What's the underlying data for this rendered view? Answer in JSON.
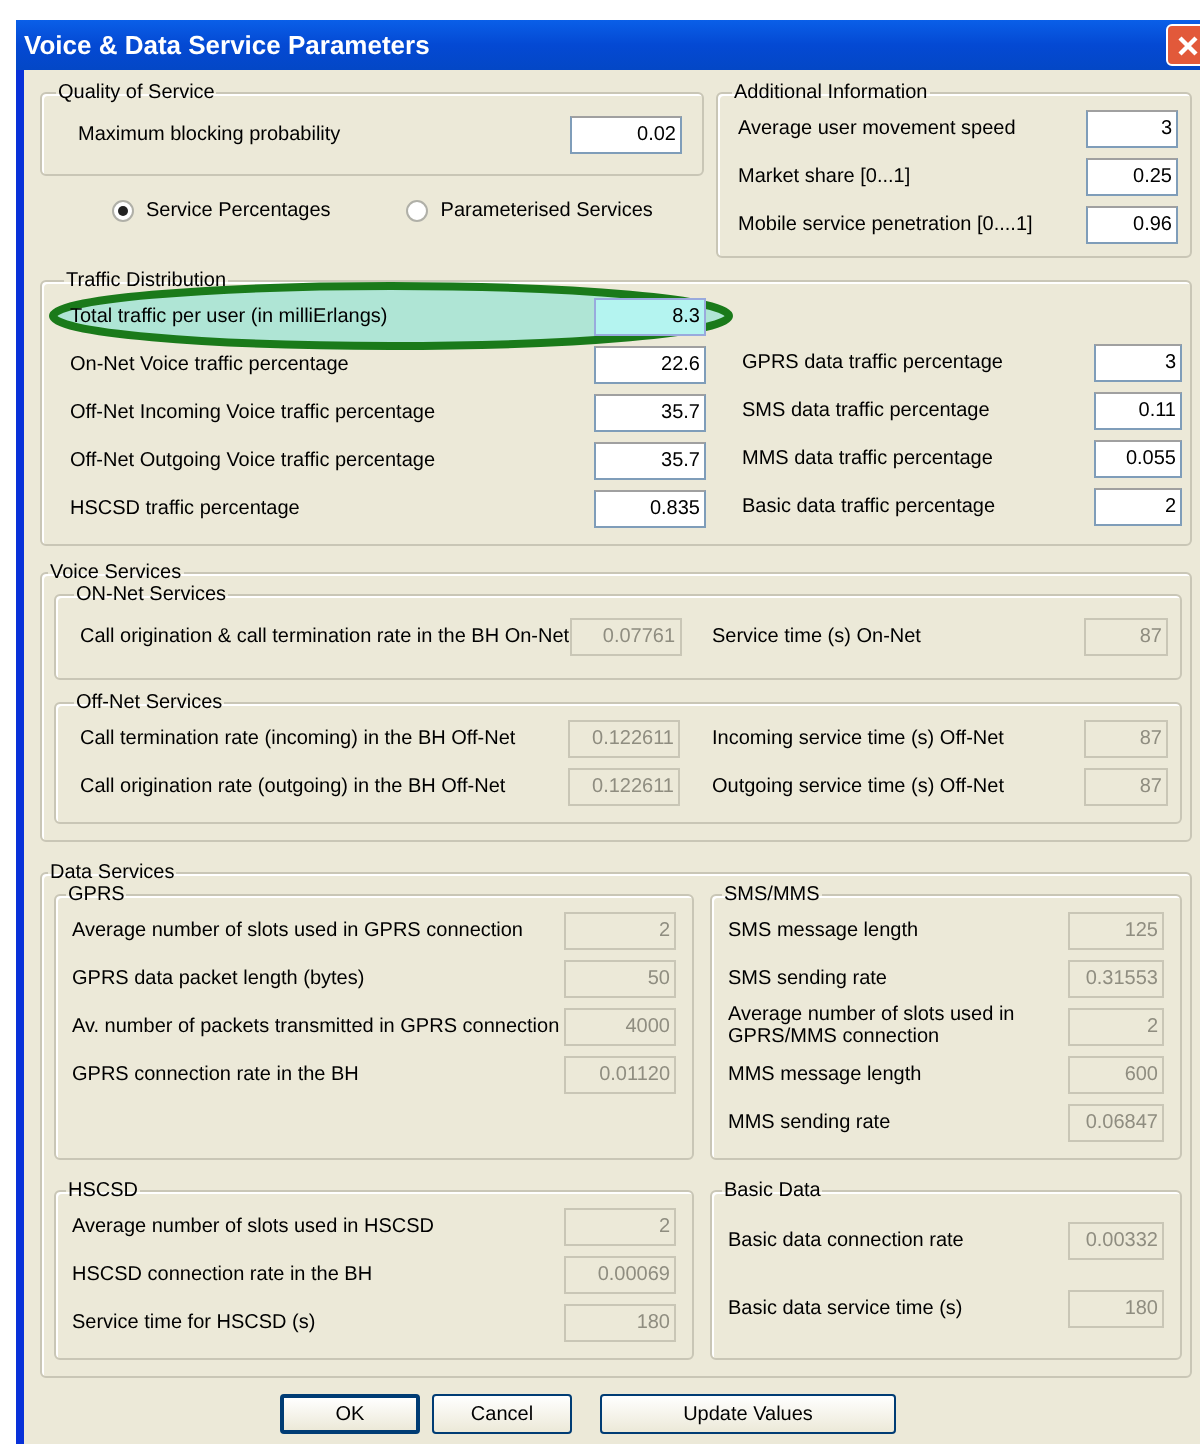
{
  "window": {
    "title": "Voice & Data Service Parameters"
  },
  "quality_of_service": {
    "title": "Quality of Service",
    "fields": [
      {
        "label": "Maximum blocking probability",
        "value": "0.02",
        "disabled": false
      }
    ]
  },
  "service_mode": [
    {
      "label": "Service Percentages",
      "selected": true
    },
    {
      "label": "Parameterised Services",
      "selected": false
    }
  ],
  "additional_information": {
    "title": "Additional Information",
    "fields": [
      {
        "label": "Average user movement speed",
        "value": "3",
        "disabled": false
      },
      {
        "label": "Market share  [0...1]",
        "value": "0.25",
        "disabled": false
      },
      {
        "label": "Mobile service penetration   [0....1]",
        "value": "0.96",
        "disabled": false
      }
    ]
  },
  "traffic_distribution": {
    "title": "Traffic Distribution",
    "left": [
      {
        "label": "Total traffic per user (in milliErlangs)",
        "value": "8.3",
        "disabled": false,
        "highlighted": true
      },
      {
        "label": "On-Net Voice traffic percentage",
        "value": "22.6",
        "disabled": false,
        "highlighted": false
      },
      {
        "label": "Off-Net Incoming Voice traffic percentage",
        "value": "35.7",
        "disabled": false,
        "highlighted": false
      },
      {
        "label": "Off-Net Outgoing Voice traffic percentage",
        "value": "35.7",
        "disabled": false,
        "highlighted": false
      },
      {
        "label": "HSCSD traffic percentage",
        "value": "0.835",
        "disabled": false,
        "highlighted": false
      }
    ],
    "right": [
      {
        "label": "GPRS data traffic percentage",
        "value": "3",
        "disabled": false
      },
      {
        "label": "SMS data traffic percentage",
        "value": "0.11",
        "disabled": false
      },
      {
        "label": "MMS data traffic percentage",
        "value": "0.055",
        "disabled": false
      },
      {
        "label": "Basic data traffic percentage",
        "value": "2",
        "disabled": false
      }
    ]
  },
  "voice_services": {
    "title": "Voice Services",
    "groups": [
      {
        "title": "ON-Net Services",
        "left": [
          {
            "label": "Call origination & call termination rate in the BH On-Net",
            "value": "0.07761",
            "disabled": true
          }
        ],
        "right": [
          {
            "label": "Service time (s) On-Net",
            "value": "87",
            "disabled": true
          }
        ]
      },
      {
        "title": "Off-Net Services",
        "left": [
          {
            "label": "Call termination rate (incoming) in the BH Off-Net",
            "value": "0.122611",
            "disabled": true
          },
          {
            "label": "Call origination rate (outgoing) in the BH Off-Net",
            "value": "0.122611",
            "disabled": true
          }
        ],
        "right": [
          {
            "label": "Incoming service time (s) Off-Net",
            "value": "87",
            "disabled": true
          },
          {
            "label": "Outgoing service time (s) Off-Net",
            "value": "87",
            "disabled": true
          }
        ]
      }
    ]
  },
  "data_services": {
    "title": "Data Services",
    "groups": [
      {
        "title": "GPRS",
        "fields": [
          {
            "label": "Average number of slots used in GPRS connection",
            "value": "2",
            "disabled": true
          },
          {
            "label": "GPRS data packet length (bytes)",
            "value": "50",
            "disabled": true
          },
          {
            "label": "Av. number of packets transmitted in GPRS connection",
            "value": "4000",
            "disabled": true
          },
          {
            "label": "GPRS connection rate in the BH",
            "value": "0.01120",
            "disabled": true
          }
        ]
      },
      {
        "title": "SMS/MMS",
        "fields": [
          {
            "label": "SMS message length",
            "value": "125",
            "disabled": true
          },
          {
            "label": "SMS sending rate",
            "value": "0.31553",
            "disabled": true
          },
          {
            "label": "Average number of slots used in GPRS/MMS connection",
            "value": "2",
            "disabled": true
          },
          {
            "label": "MMS message length",
            "value": "600",
            "disabled": true
          },
          {
            "label": "MMS sending rate",
            "value": "0.06847",
            "disabled": true
          }
        ]
      },
      {
        "title": "HSCSD",
        "fields": [
          {
            "label": "Average number of slots used in HSCSD",
            "value": "2",
            "disabled": true
          },
          {
            "label": "HSCSD connection rate in the BH",
            "value": "0.00069",
            "disabled": true
          },
          {
            "label": "Service time for HSCSD (s)",
            "value": "180",
            "disabled": true
          }
        ]
      },
      {
        "title": "Basic Data",
        "fields": [
          {
            "label": "Basic data connection rate",
            "value": "0.00332",
            "disabled": true
          },
          {
            "label": "Basic data service time (s)",
            "value": "180",
            "disabled": true
          }
        ]
      }
    ]
  },
  "buttons": [
    {
      "label": "OK",
      "default": true
    },
    {
      "label": "Cancel",
      "default": false
    },
    {
      "label": "Update Values",
      "default": false
    }
  ]
}
